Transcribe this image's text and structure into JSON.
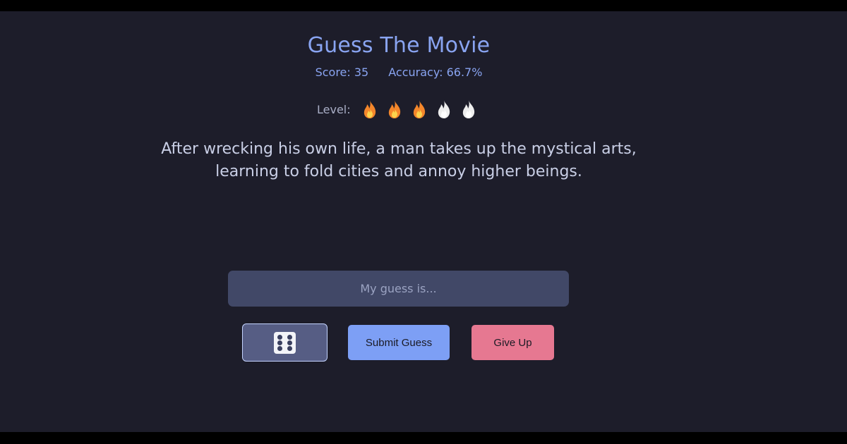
{
  "app": {
    "title": "Guess The Movie"
  },
  "stats": {
    "score_label": "Score: 35",
    "accuracy_label": "Accuracy: 66.7%"
  },
  "level": {
    "label": "Level:",
    "filled": 3,
    "total": 5,
    "icon": "fire-icon",
    "colors": {
      "filled": "#f5872b",
      "empty": "#eeeeee"
    }
  },
  "clue": {
    "line1": "After wrecking his own life, a man takes up the mystical arts,",
    "line2": "learning to fold cities and annoy higher beings."
  },
  "guess": {
    "placeholder": "My guess is...",
    "value": ""
  },
  "buttons": {
    "random_icon": "dice-six-icon",
    "submit_label": "Submit Guess",
    "give_up_label": "Give Up"
  },
  "colors": {
    "background": "#1d1d2a",
    "accent": "#89a4f1",
    "submit": "#7d9ff5",
    "give_up": "#e67891"
  }
}
